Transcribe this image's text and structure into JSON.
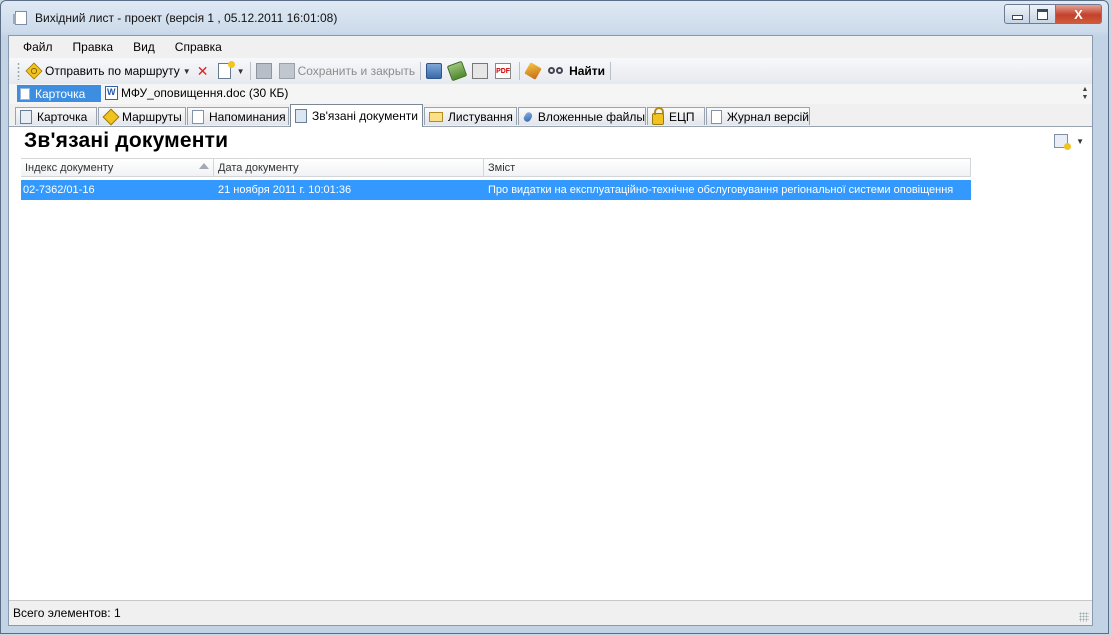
{
  "window": {
    "title": "Вихідний лист - проект (версія 1 , 05.12.2011 16:01:08)",
    "close_glyph": "X"
  },
  "menu": [
    "Файл",
    "Правка",
    "Вид",
    "Справка"
  ],
  "toolbar": {
    "send_route_label": "Отправить по маршруту",
    "save_close_label": "Сохранить и закрыть",
    "find_label": "Найти",
    "pdf_glyph": "PDF"
  },
  "attachments": {
    "card_label": "Карточка",
    "file_label": "МФУ_оповищення.doc (30 КБ)"
  },
  "tabs": [
    {
      "label": "Карточка",
      "icon": "card-icon"
    },
    {
      "label": "Маршруты",
      "icon": "route-icon"
    },
    {
      "label": "Напоминания",
      "icon": "reminder-icon"
    },
    {
      "label": "Зв'язані документи",
      "icon": "linked-docs-icon"
    },
    {
      "label": "Листування",
      "icon": "mail-icon"
    },
    {
      "label": "Вложенные файлы",
      "icon": "paperclip-icon"
    },
    {
      "label": "ЕЦП",
      "icon": "lock-icon"
    },
    {
      "label": "Журнал версій",
      "icon": "journal-icon"
    }
  ],
  "panel": {
    "title": "Зв'язані документи"
  },
  "grid": {
    "columns": [
      "Індекс документу",
      "Дата документу",
      "Зміст"
    ],
    "sorted_column": "Індекс документу",
    "sort_direction": "ascending",
    "rows": [
      {
        "index": "02-7362/01-16",
        "date": "21 ноября 2011 г. 10:01:36",
        "content": "Про  видатки на експлуатаційно-технічне обслуговування регіональної системи оповіщення",
        "selected": true
      }
    ]
  },
  "status": {
    "total_label": "Всего элементов: 1"
  },
  "colors": {
    "selection": "#3399ff",
    "attachment_card": "#3d8ee0",
    "close_button": "#c2412c"
  }
}
